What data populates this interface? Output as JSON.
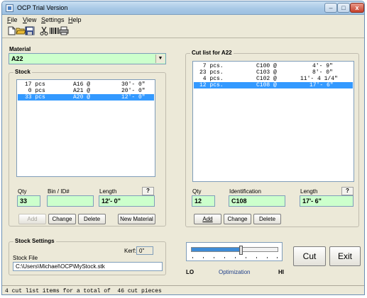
{
  "window": {
    "title": "OCP Trial Version",
    "minimize": "–",
    "maximize": "□",
    "close": "x"
  },
  "menu": [
    {
      "key": "F",
      "rest": "ile"
    },
    {
      "key": "V",
      "rest": "iew"
    },
    {
      "key": "S",
      "rest": "ettings"
    },
    {
      "key": "H",
      "rest": "elp"
    }
  ],
  "toolbar": {
    "icons": [
      "new-file-icon",
      "open-folder-icon",
      "save-icon",
      "cut-icon",
      "barcode-icon",
      "print-icon"
    ]
  },
  "material": {
    "label": "Material",
    "value": "A22",
    "arrow": "▼"
  },
  "stock": {
    "title": "Stock",
    "rows": [
      {
        "qty": "17 pcs",
        "id": "A16 @",
        "length": "30'- 0\"",
        "selected": false
      },
      {
        "qty": " 0 pcs",
        "id": "A21 @",
        "length": "20'- 0\"",
        "selected": false
      },
      {
        "qty": "33 pcs",
        "id": "A20 @",
        "length": "12'- 0\"",
        "selected": true
      }
    ],
    "qty_label": "Qty",
    "bin_label": "Bin / ID#",
    "length_label": "Length",
    "help": "?",
    "qty_value": "33",
    "bin_value": "",
    "length_value": "12'- 0\"",
    "buttons": {
      "add": "Add",
      "change": "Change",
      "delete": "Delete",
      "new_material": "New Material"
    }
  },
  "cutlist": {
    "title": "Cut list for A22",
    "rows": [
      {
        "qty": " 7 pcs.",
        "id": "C100 @",
        "length": "4'- 9\"",
        "selected": false
      },
      {
        "qty": "23 pcs.",
        "id": "C103 @",
        "length": "8'- 0\"",
        "selected": false
      },
      {
        "qty": " 4 pcs.",
        "id": "C102 @",
        "length": "11'- 4 1/4\"",
        "selected": false
      },
      {
        "qty": "12 pcs.",
        "id": "C108 @",
        "length": "17'- 6\"",
        "selected": true
      }
    ],
    "qty_label": "Qty",
    "ident_label": "Identification",
    "length_label": "Length",
    "help": "?",
    "qty_value": "12",
    "ident_value": "C108",
    "length_value": "17'- 6\"",
    "buttons": {
      "add": "Add",
      "change": "Change",
      "delete": "Delete"
    }
  },
  "stock_settings": {
    "title": "Stock Settings",
    "kerf_label": "Kerf:",
    "kerf_value": "0\"",
    "file_label": "Stock File",
    "file_value": "C:\\Users\\Michael\\OCP\\MyStock.stk"
  },
  "optimization": {
    "lo": "LO",
    "label": "Optimization",
    "hi": "HI",
    "level_percent": 56
  },
  "actions": {
    "cut": "Cut",
    "exit": "Exit"
  },
  "status": {
    "text": "4 cut list items for a total of  46 cut pieces"
  }
}
